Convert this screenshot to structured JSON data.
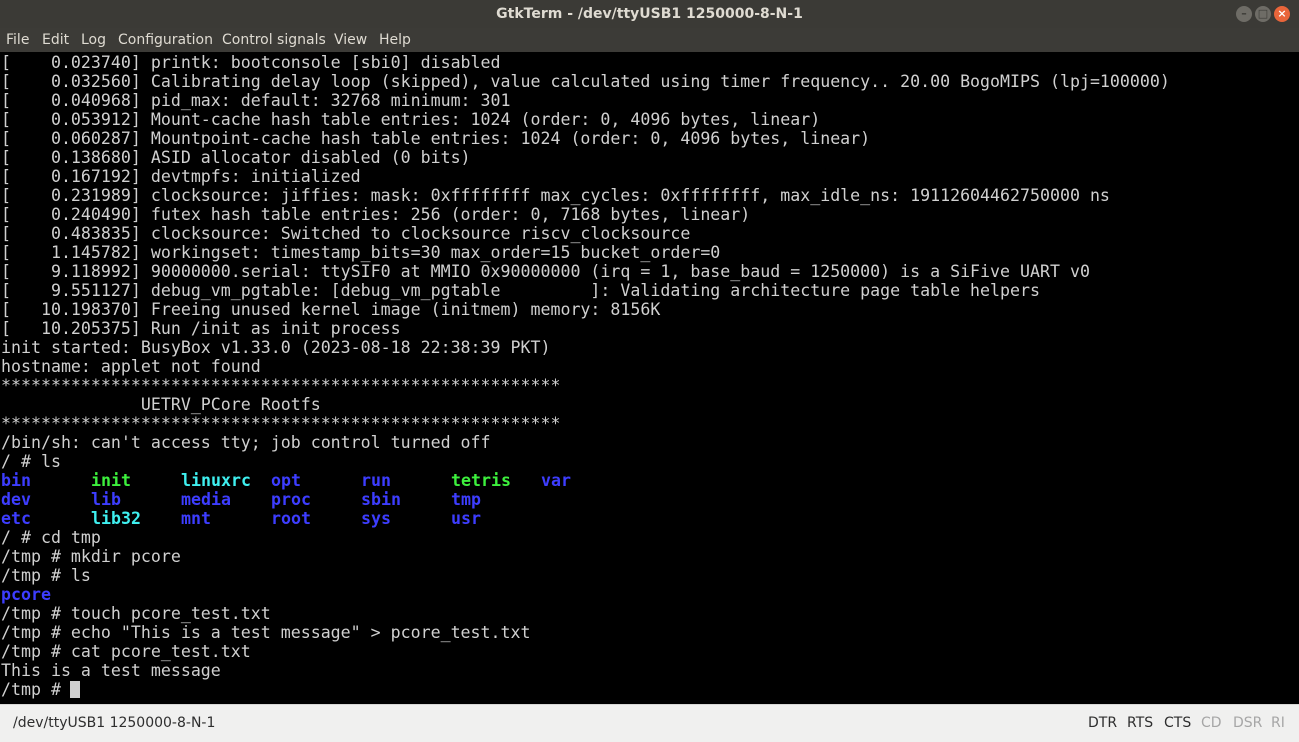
{
  "window": {
    "title": "GtkTerm - /dev/ttyUSB1  1250000-8-N-1"
  },
  "menu": [
    "File",
    "Edit",
    "Log",
    "Configuration",
    "Control signals",
    "View",
    "Help"
  ],
  "terminal": {
    "lines": [
      "[    0.023740] printk: bootconsole [sbi0] disabled",
      "[    0.032560] Calibrating delay loop (skipped), value calculated using timer frequency.. 20.00 BogoMIPS (lpj=100000)",
      "[    0.040968] pid_max: default: 32768 minimum: 301",
      "[    0.053912] Mount-cache hash table entries: 1024 (order: 0, 4096 bytes, linear)",
      "[    0.060287] Mountpoint-cache hash table entries: 1024 (order: 0, 4096 bytes, linear)",
      "[    0.138680] ASID allocator disabled (0 bits)",
      "[    0.167192] devtmpfs: initialized",
      "[    0.231989] clocksource: jiffies: mask: 0xffffffff max_cycles: 0xffffffff, max_idle_ns: 19112604462750000 ns",
      "[    0.240490] futex hash table entries: 256 (order: 0, 7168 bytes, linear)",
      "[    0.483835] clocksource: Switched to clocksource riscv_clocksource",
      "[    1.145782] workingset: timestamp_bits=30 max_order=15 bucket_order=0",
      "[    9.118992] 90000000.serial: ttySIF0 at MMIO 0x90000000 (irq = 1, base_baud = 1250000) is a SiFive UART v0",
      "[    9.551127] debug_vm_pgtable: [debug_vm_pgtable         ]: Validating architecture page table helpers",
      "[   10.198370] Freeing unused kernel image (initmem) memory: 8156K",
      "[   10.205375] Run /init as init process",
      "init started: BusyBox v1.33.0 (2023-08-18 22:38:39 PKT)",
      "hostname: applet not found",
      "********************************************************",
      "              UETRV_PCore Rootfs",
      "********************************************************",
      "/bin/sh: can't access tty; job control turned off",
      "/ # ls"
    ],
    "ls_output": [
      [
        "bin",
        "init",
        "linuxrc",
        "opt",
        "run",
        "tetris",
        "var"
      ],
      [
        "dev",
        "lib",
        "media",
        "proc",
        "sbin",
        "tmp"
      ],
      [
        "etc",
        "lib32",
        "mnt",
        "root",
        "sys",
        "usr"
      ]
    ],
    "ls_types": [
      [
        "dir",
        "exe",
        "lnk",
        "dir",
        "dir",
        "exe",
        "dir"
      ],
      [
        "dir",
        "dir",
        "dir",
        "dir",
        "dir",
        "dir"
      ],
      [
        "dir",
        "lnk",
        "dir",
        "dir",
        "dir",
        "dir"
      ]
    ],
    "after_lines": [
      "/ # cd tmp",
      "/tmp # mkdir pcore",
      "/tmp # ls"
    ],
    "tmp_ls": "pcore",
    "final_lines": [
      "/tmp # touch pcore_test.txt",
      "/tmp # echo \"This is a test message\" > pcore_test.txt",
      "/tmp # cat pcore_test.txt",
      "This is a test message"
    ],
    "prompt": "/tmp # "
  },
  "status": {
    "port": "/dev/ttyUSB1  1250000-8-N-1",
    "signals": [
      {
        "label": "DTR",
        "active": true
      },
      {
        "label": "RTS",
        "active": true
      },
      {
        "label": "CTS",
        "active": true
      },
      {
        "label": "CD",
        "active": false
      },
      {
        "label": "DSR",
        "active": false
      },
      {
        "label": "RI",
        "active": false
      }
    ]
  },
  "colors": {
    "dir": "#3d3dff",
    "exe": "#3df03d",
    "lnk": "#3ff0f0",
    "close": "#e9653a"
  }
}
